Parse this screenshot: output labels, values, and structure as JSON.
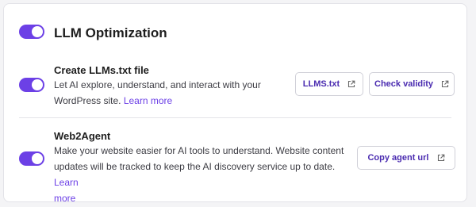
{
  "section": {
    "title": "LLM Optimization",
    "enabled": true
  },
  "rows": [
    {
      "title": "Create LLMs.txt file",
      "description_line1": "Let AI explore, understand, and interact with your",
      "description_line2": "WordPress site.",
      "link": "Learn more",
      "enabled": true,
      "buttons": [
        {
          "label": "LLMS.txt",
          "icon": "external-link-icon"
        },
        {
          "label": "Check validity",
          "icon": "external-link-icon"
        }
      ]
    },
    {
      "title": "Web2Agent",
      "description_line1": "Make your website easier for AI tools to understand. Website content",
      "description_line2": "updates will be tracked to keep the AI discovery service up to date.",
      "link_part1": "Learn",
      "link_part2": "more",
      "enabled": true,
      "buttons": [
        {
          "label": "Copy agent url",
          "icon": "external-link-icon"
        }
      ]
    }
  ],
  "colors": {
    "accent": "#6c40e6",
    "button_text": "#4a2bb0",
    "background": "#f4f4f6"
  }
}
